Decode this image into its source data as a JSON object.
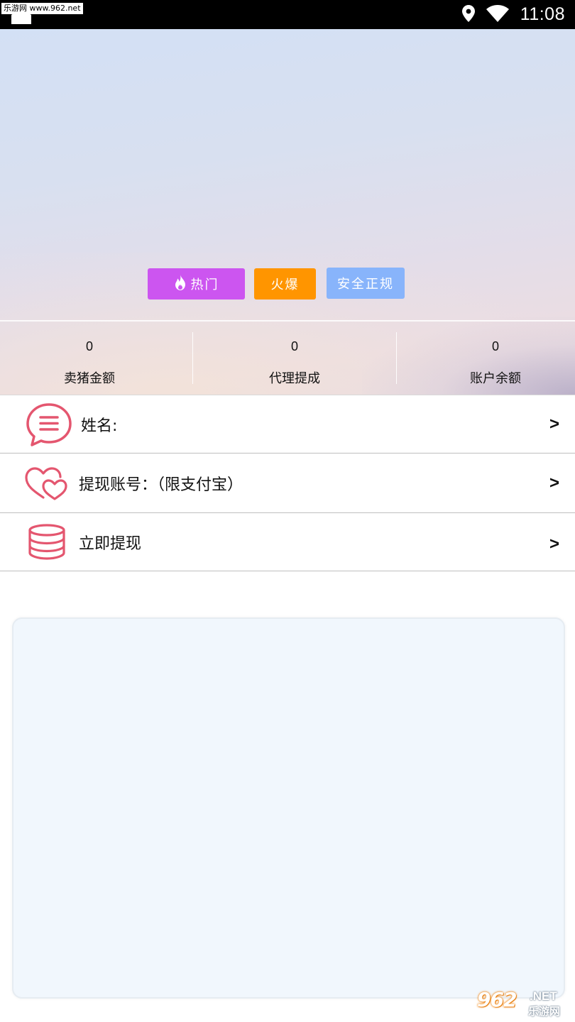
{
  "status_bar": {
    "watermark": "乐游网 www.962.net",
    "time": "11:08",
    "icons": [
      "location-icon",
      "wifi-icon"
    ]
  },
  "hero": {
    "tags": [
      {
        "label": "热门",
        "icon": "flame-icon",
        "color": "#cc55f0"
      },
      {
        "label": "火爆",
        "color": "#ff9500"
      },
      {
        "label": "安全正规",
        "color": "#88b4fb"
      }
    ],
    "stats": [
      {
        "value": "0",
        "label": "卖猪金额"
      },
      {
        "value": "0",
        "label": "代理提成"
      },
      {
        "value": "0",
        "label": "账户余额"
      }
    ]
  },
  "menu": {
    "items": [
      {
        "icon": "message-bubble-icon",
        "label": "姓名:",
        "arrow": ">"
      },
      {
        "icon": "hearts-icon",
        "label": "提现账号：（限支付宝）",
        "arrow": ">"
      },
      {
        "icon": "coin-stack-icon",
        "label": "立即提现",
        "arrow": ">"
      }
    ]
  },
  "brand_watermark": {
    "number": "962",
    "suffix": ".NET",
    "name": "乐游网"
  },
  "colors": {
    "accent_pink": "#e4566f",
    "hot_tag": "#cc55f0",
    "fire_tag": "#ff9500",
    "safe_tag": "#88b4fb",
    "panel_bg": "#f1f7fd"
  }
}
